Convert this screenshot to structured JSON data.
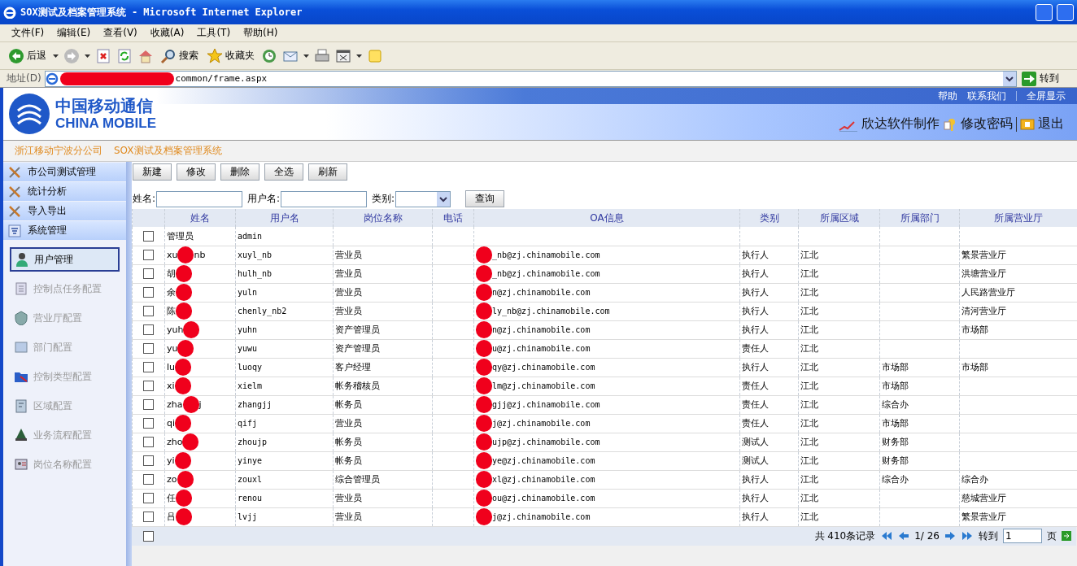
{
  "window": {
    "title": "SOX测试及档案管理系统 - Microsoft Internet Explorer"
  },
  "menu": [
    "文件(F)",
    "编辑(E)",
    "查看(V)",
    "收藏(A)",
    "工具(T)",
    "帮助(H)"
  ],
  "toolbar": [
    {
      "kind": "back",
      "label": "后退",
      "dropdown": true
    },
    {
      "kind": "forward",
      "dropdown": true
    },
    {
      "kind": "stop",
      "dropdown": false
    },
    {
      "kind": "refresh",
      "dropdown": false
    },
    {
      "kind": "home",
      "dropdown": false
    },
    {
      "kind": "search",
      "label": "搜索",
      "dropdown": false
    },
    {
      "kind": "favorites",
      "label": "收藏夹",
      "dropdown": false
    },
    {
      "kind": "history",
      "dropdown": false
    },
    {
      "kind": "mail",
      "dropdown": true
    },
    {
      "kind": "print",
      "dropdown": false
    },
    {
      "kind": "edit",
      "dropdown": true
    },
    {
      "kind": "note",
      "dropdown": false
    }
  ],
  "address": {
    "label": "地址(D)",
    "value": "common/frame.aspx",
    "go": "转到"
  },
  "banner": {
    "logo_cn": "中国移动通信",
    "logo_en": "CHINA MOBILE",
    "links": [
      "帮助",
      "联系我们",
      "全屏显示"
    ],
    "actions": [
      {
        "kind": "vendor",
        "label": "欣达软件制作"
      },
      {
        "kind": "password",
        "label": "修改密码"
      },
      {
        "kind": "logout",
        "label": "退出"
      }
    ]
  },
  "breadcrumb": [
    "浙江移动宁波分公司",
    "SOX测试及档案管理系统"
  ],
  "sidebar": {
    "groups": [
      {
        "label": "市公司测试管理",
        "expanded": false
      },
      {
        "label": "统计分析",
        "expanded": false
      },
      {
        "label": "导入导出",
        "expanded": false
      },
      {
        "label": "系统管理",
        "expanded": true,
        "items": [
          {
            "kind": "user",
            "label": "用户管理",
            "selected": true
          },
          {
            "kind": "task",
            "label": "控制点任务配置",
            "selected": false
          },
          {
            "kind": "hall",
            "label": "营业厅配置",
            "selected": false
          },
          {
            "kind": "dept",
            "label": "部门配置",
            "selected": false
          },
          {
            "kind": "type",
            "label": "控制类型配置",
            "selected": false
          },
          {
            "kind": "region",
            "label": "区域配置",
            "selected": false
          },
          {
            "kind": "flow",
            "label": "业务流程配置",
            "selected": false
          },
          {
            "kind": "post",
            "label": "岗位名称配置",
            "selected": false
          }
        ]
      }
    ]
  },
  "actions": [
    "新建",
    "修改",
    "删除",
    "全选",
    "刷新"
  ],
  "filters": [
    {
      "kind": "text",
      "label": "姓名:"
    },
    {
      "kind": "text",
      "label": "用户名:"
    },
    {
      "kind": "select",
      "label": "类别:"
    }
  ],
  "query_button": "查询",
  "table": {
    "columns": [
      "姓名",
      "用户名",
      "岗位名称",
      "电话",
      "OA信息",
      "类别",
      "所属区域",
      "所属部门",
      "所属营业厅"
    ],
    "rows": [
      {
        "checked": false,
        "redacted": false,
        "name": [
          "管理员"
        ],
        "username": "admin"
      },
      {
        "checked": false,
        "redacted": true,
        "name": [
          "xu",
          "nb"
        ],
        "username": "xuyl_nb",
        "position": "营业员",
        "oa": "_nb@zj.chinamobile.com",
        "category": "执行人",
        "region": "江北",
        "hall": "繁景营业厅"
      },
      {
        "checked": false,
        "redacted": true,
        "name": [
          "胡"
        ],
        "username": "hulh_nb",
        "position": "营业员",
        "oa": "_nb@zj.chinamobile.com",
        "category": "执行人",
        "region": "江北",
        "hall": "洪塘营业厅"
      },
      {
        "checked": false,
        "redacted": true,
        "name": [
          "余"
        ],
        "username": "yuln",
        "position": "营业员",
        "oa": "n@zj.chinamobile.com",
        "category": "执行人",
        "region": "江北",
        "hall": "人民路营业厅"
      },
      {
        "checked": false,
        "redacted": true,
        "name": [
          "陈"
        ],
        "username": "chenly_nb2",
        "position": "营业员",
        "oa": "ly_nb@zj.chinamobile.com",
        "category": "执行人",
        "region": "江北",
        "hall": "清河营业厅"
      },
      {
        "checked": false,
        "redacted": true,
        "name": [
          "yuh"
        ],
        "username": "yuhn",
        "position": "资产管理员",
        "oa": "n@zj.chinamobile.com",
        "category": "执行人",
        "region": "江北",
        "hall": "市场部"
      },
      {
        "checked": false,
        "redacted": true,
        "name": [
          "yu"
        ],
        "username": "yuwu",
        "position": "资产管理员",
        "oa": "u@zj.chinamobile.com",
        "category": "责任人",
        "region": "江北"
      },
      {
        "checked": false,
        "redacted": true,
        "name": [
          "lu"
        ],
        "username": "luoqy",
        "position": "客户经理",
        "oa": "qy@zj.chinamobile.com",
        "category": "执行人",
        "region": "江北",
        "department": "市场部",
        "hall": "市场部"
      },
      {
        "checked": false,
        "redacted": true,
        "name": [
          "xi"
        ],
        "username": "xielm",
        "position": "帐务稽核员",
        "oa": "lm@zj.chinamobile.com",
        "category": "责任人",
        "region": "江北",
        "department": "市场部"
      },
      {
        "checked": false,
        "redacted": true,
        "name": [
          "zha",
          "j"
        ],
        "username": "zhangjj",
        "position": "帐务员",
        "oa": "gjj@zj.chinamobile.com",
        "category": "责任人",
        "region": "江北",
        "department": "综合办"
      },
      {
        "checked": false,
        "redacted": true,
        "name": [
          "qi"
        ],
        "username": "qifj",
        "position": "营业员",
        "oa": "j@zj.chinamobile.com",
        "category": "责任人",
        "region": "江北",
        "department": "市场部"
      },
      {
        "checked": false,
        "redacted": true,
        "name": [
          "zho"
        ],
        "username": "zhoujp",
        "position": "帐务员",
        "oa": "ujp@zj.chinamobile.com",
        "category": "测试人",
        "region": "江北",
        "department": "财务部"
      },
      {
        "checked": false,
        "redacted": true,
        "name": [
          "yi"
        ],
        "username": "yinye",
        "position": "帐务员",
        "oa": "ye@zj.chinamobile.com",
        "category": "测试人",
        "region": "江北",
        "department": "财务部"
      },
      {
        "checked": false,
        "redacted": true,
        "name": [
          "zo"
        ],
        "username": "zouxl",
        "position": "综合管理员",
        "oa": "xl@zj.chinamobile.com",
        "category": "执行人",
        "region": "江北",
        "department": "综合办",
        "hall": "综合办"
      },
      {
        "checked": false,
        "redacted": true,
        "name": [
          "任"
        ],
        "username": "renou",
        "position": "营业员",
        "oa": "ou@zj.chinamobile.com",
        "category": "执行人",
        "region": "江北",
        "hall": "慈城营业厅"
      },
      {
        "checked": false,
        "redacted": true,
        "name": [
          "吕"
        ],
        "username": "lvjj",
        "position": "营业员",
        "oa": "j@zj.chinamobile.com",
        "category": "执行人",
        "region": "江北",
        "hall": "繁景营业厅"
      }
    ]
  },
  "pager": {
    "checked": false,
    "total": "共 410条记录",
    "page": "1/ 26",
    "goto": "转到",
    "page_input": "1",
    "unit": "页"
  }
}
